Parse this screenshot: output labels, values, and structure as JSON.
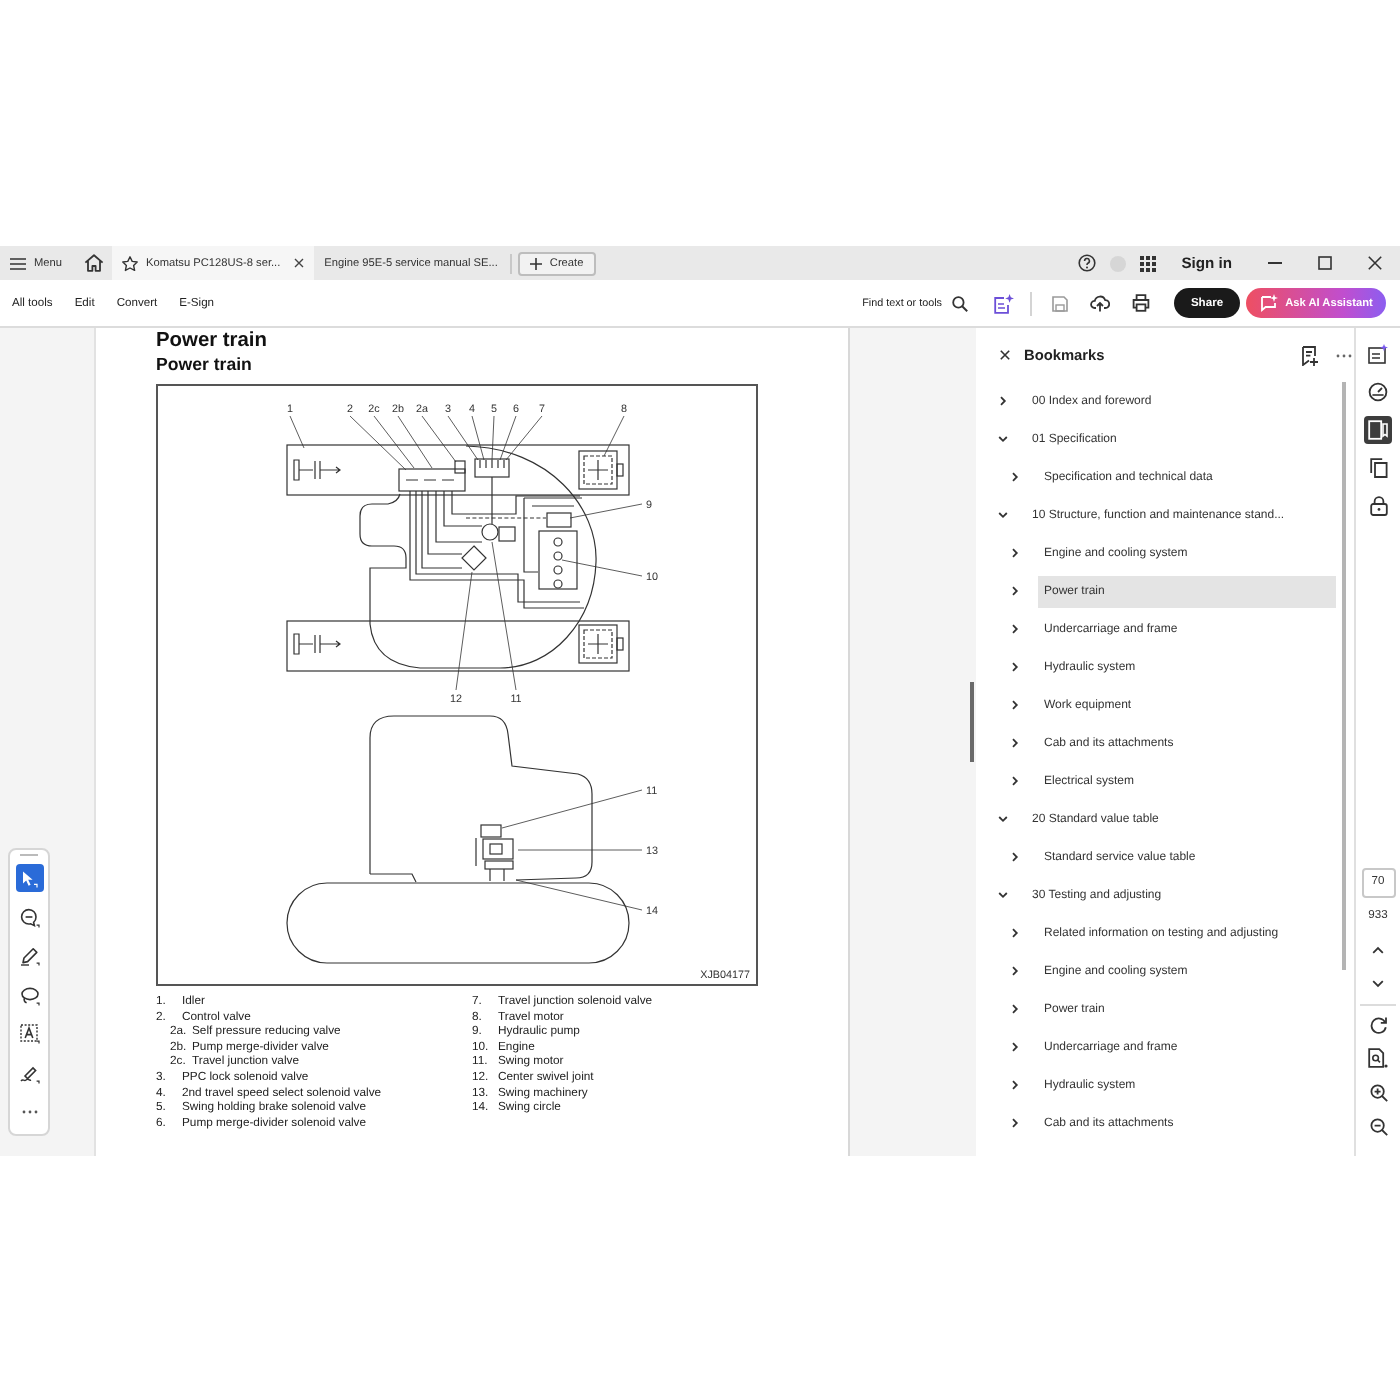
{
  "title_bar": {
    "menu_label": "Menu",
    "tabs": [
      {
        "label": "Komatsu PC128US-8 ser...",
        "selected": true
      },
      {
        "label": "Engine 95E-5 service manual SE...",
        "selected": false
      }
    ],
    "create_label": "Create",
    "sign_in_label": "Sign in"
  },
  "toolbar": {
    "menu_items": [
      "All tools",
      "Edit",
      "Convert",
      "E-Sign"
    ],
    "search_label": "Find text or tools",
    "share_label": "Share",
    "assistant_label": "Ask AI Assistant"
  },
  "tool_palette": [
    {
      "kind": "select",
      "selected": true
    },
    {
      "kind": "comment",
      "selected": false
    },
    {
      "kind": "pen",
      "selected": false
    },
    {
      "kind": "lasso",
      "selected": false
    },
    {
      "kind": "text-box",
      "selected": false
    },
    {
      "kind": "signature",
      "selected": false
    },
    {
      "kind": "more",
      "selected": false
    }
  ],
  "document": {
    "title": "Power train",
    "subtitle": "Power train",
    "diagram": {
      "callouts": [
        "1",
        "2",
        "2c",
        "2b",
        "2a",
        "3",
        "4",
        "5",
        "6",
        "7",
        "8",
        "9",
        "10",
        "12",
        "11",
        "11",
        "13",
        "14"
      ],
      "figure_code": "XJB04177"
    },
    "legend": {
      "columns": [
        [
          {
            "number": "1.",
            "text": "Idler"
          },
          {
            "number": "2.",
            "text": "Control valve",
            "children": [
              {
                "number": "2a.",
                "text": "Self pressure reducing valve"
              },
              {
                "number": "2b.",
                "text": "Pump merge-divider valve"
              },
              {
                "number": "2c.",
                "text": "Travel junction valve"
              }
            ]
          },
          {
            "number": "3.",
            "text": "PPC lock solenoid valve"
          },
          {
            "number": "4.",
            "text": "2nd travel speed select solenoid valve"
          },
          {
            "number": "5.",
            "text": "Swing holding brake solenoid valve"
          },
          {
            "number": "6.",
            "text": "Pump merge-divider solenoid valve"
          }
        ],
        [
          {
            "number": "7.",
            "text": "Travel junction solenoid valve"
          },
          {
            "number": "8.",
            "text": "Travel motor"
          },
          {
            "number": "9.",
            "text": "Hydraulic pump"
          },
          {
            "number": "10.",
            "text": "Engine"
          },
          {
            "number": "11.",
            "text": "Swing motor"
          },
          {
            "number": "12.",
            "text": "Center swivel joint"
          },
          {
            "number": "13.",
            "text": "Swing machinery"
          },
          {
            "number": "14.",
            "text": "Swing circle"
          }
        ]
      ]
    }
  },
  "bookmarks": {
    "title": "Bookmarks",
    "items": [
      {
        "label": "00 Index and foreword",
        "expanded": false,
        "selected": false
      },
      {
        "label": "01 Specification",
        "expanded": true,
        "selected": false,
        "children": [
          {
            "label": "Specification and technical data",
            "expanded": false,
            "selected": false
          }
        ]
      },
      {
        "label": "10 Structure, function and maintenance stand...",
        "expanded": true,
        "selected": false,
        "children": [
          {
            "label": "Engine and cooling system",
            "expanded": false,
            "selected": false
          },
          {
            "label": "Power train",
            "expanded": false,
            "selected": true
          },
          {
            "label": "Undercarriage and frame",
            "expanded": false,
            "selected": false
          },
          {
            "label": "Hydraulic system",
            "expanded": false,
            "selected": false
          },
          {
            "label": "Work equipment",
            "expanded": false,
            "selected": false
          },
          {
            "label": "Cab and its attachments",
            "expanded": false,
            "selected": false
          },
          {
            "label": "Electrical system",
            "expanded": false,
            "selected": false
          }
        ]
      },
      {
        "label": "20 Standard value table",
        "expanded": true,
        "selected": false,
        "children": [
          {
            "label": "Standard service value table",
            "expanded": false,
            "selected": false
          }
        ]
      },
      {
        "label": "30 Testing and adjusting",
        "expanded": true,
        "selected": false,
        "children": [
          {
            "label": "Related information on testing and adjusting",
            "expanded": false,
            "selected": false
          },
          {
            "label": "Engine and cooling system",
            "expanded": false,
            "selected": false
          },
          {
            "label": "Power train",
            "expanded": false,
            "selected": false
          },
          {
            "label": "Undercarriage and frame",
            "expanded": false,
            "selected": false
          },
          {
            "label": "Hydraulic system",
            "expanded": false,
            "selected": false
          },
          {
            "label": "Cab and its attachments",
            "expanded": false,
            "selected": false
          }
        ]
      }
    ]
  },
  "right_rail": {
    "tools": [
      {
        "kind": "summary",
        "selected": false
      },
      {
        "kind": "gauge",
        "selected": false
      },
      {
        "kind": "bookmarks",
        "selected": true
      },
      {
        "kind": "pages",
        "selected": false
      },
      {
        "kind": "lock",
        "selected": false
      }
    ],
    "page_number": "70",
    "page_count": "933",
    "nav_tools": [
      {
        "kind": "up"
      },
      {
        "kind": "down"
      },
      {
        "kind": "rotate"
      },
      {
        "kind": "export"
      },
      {
        "kind": "zoom-in"
      },
      {
        "kind": "zoom-out"
      }
    ]
  }
}
